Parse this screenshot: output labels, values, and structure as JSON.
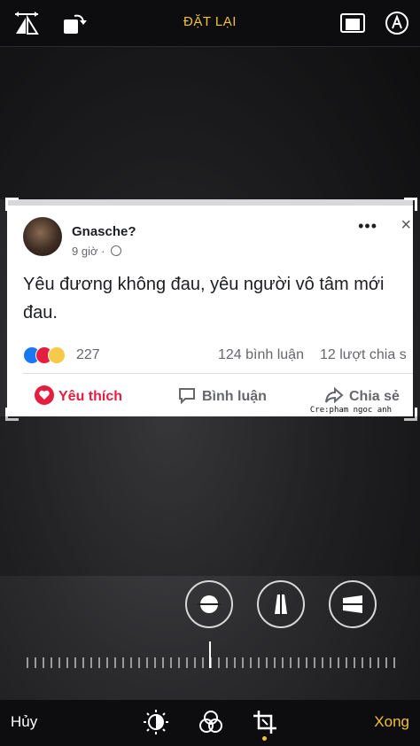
{
  "toolbar": {
    "title": "ĐẶT LẠI",
    "icons": [
      "flip-icon",
      "rotate-icon",
      "aspect-ratio-icon",
      "auto-enhance-icon"
    ]
  },
  "post": {
    "author": "Gnasche?",
    "time": "9 giờ",
    "text": "Yêu đương không đau, yêu người vô tâm mới đau.",
    "reaction_count": "227",
    "comments": "124 bình luận",
    "shares": "12 lượt chia s",
    "like_label": "Yêu thích",
    "comment_label": "Bình luận",
    "share_label": "Chia sẻ",
    "credit": "Cre:pham ngoc anh",
    "more": "•••",
    "close": "×"
  },
  "bottom": {
    "cancel": "Hủy",
    "done": "Xong"
  },
  "colors": {
    "accent": "#f2c230",
    "like_red": "#e41e3f",
    "fb_blue": "#1877f2"
  }
}
